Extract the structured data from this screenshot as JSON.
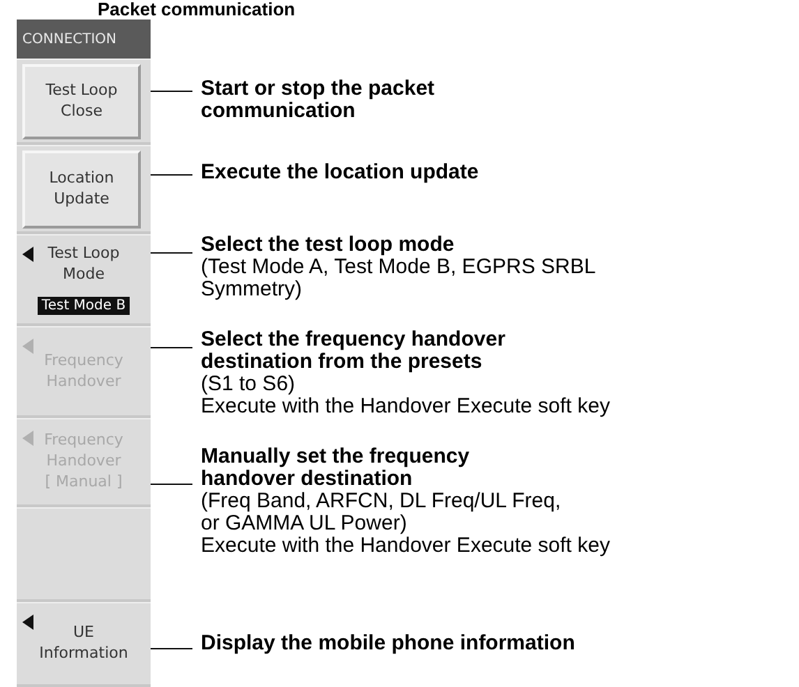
{
  "heading": "Packet communication",
  "panel": {
    "title": "CONNECTION"
  },
  "keys": [
    {
      "kind": "button",
      "label": "Test Loop\nClose",
      "disabled": false,
      "description": {
        "title": "Start or stop the packet\ncommunication"
      }
    },
    {
      "kind": "button",
      "label": "Location\nUpdate",
      "disabled": false,
      "description": {
        "title": "Execute the location update"
      }
    },
    {
      "kind": "menu",
      "label": "Test Loop\nMode",
      "value": "Test Mode B",
      "disabled": false,
      "description": {
        "title": "Select the test loop mode",
        "details": [
          "(Test Mode A, Test Mode B, EGPRS SRBL\nSymmetry)"
        ]
      }
    },
    {
      "kind": "menu",
      "label": "Frequency\nHandover",
      "disabled": true,
      "description": {
        "title": "Select the frequency handover\ndestination from the presets",
        "details": [
          "(S1 to S6)",
          "Execute with the Handover Execute soft key"
        ]
      }
    },
    {
      "kind": "menu",
      "label": "Frequency\nHandover\n[ Manual ]",
      "disabled": true,
      "description": {
        "title": "Manually set the frequency\nhandover destination",
        "details": [
          "(Freq Band, ARFCN, DL Freq/UL Freq,\nor GAMMA UL Power)",
          "Execute with the Handover Execute soft key"
        ]
      }
    },
    {
      "kind": "blank"
    },
    {
      "kind": "menu",
      "label": "UE\nInformation",
      "disabled": false,
      "description": {
        "title": "Display the mobile phone information"
      }
    }
  ]
}
